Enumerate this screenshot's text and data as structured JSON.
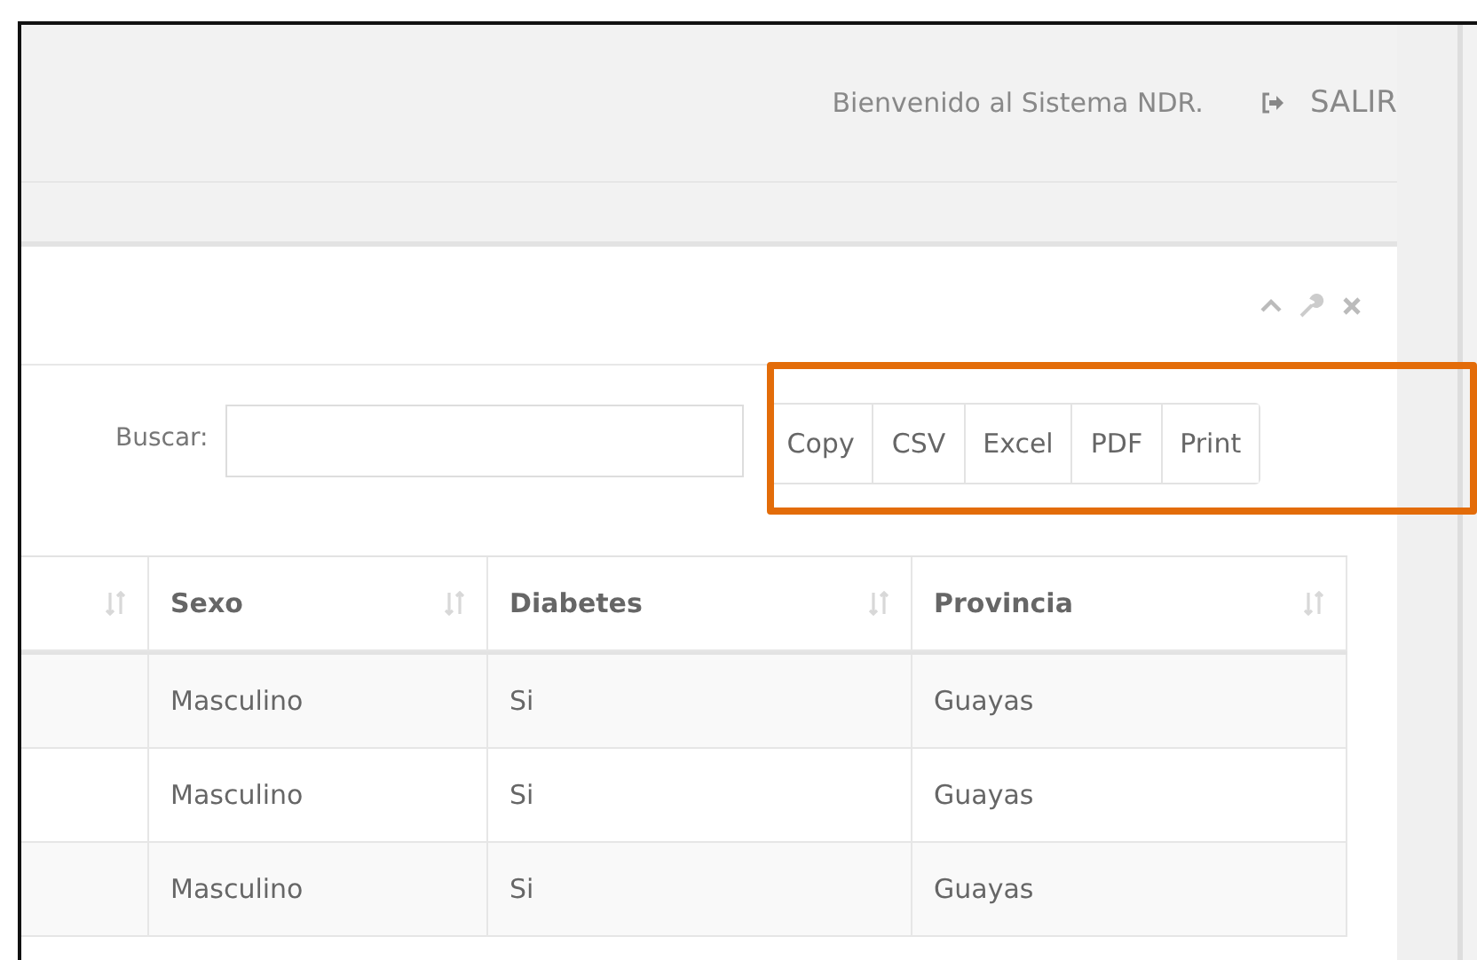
{
  "header": {
    "welcome": "Bienvenido al Sistema NDR.",
    "logout": "SALIR"
  },
  "panel": {
    "search_label": "Buscar:",
    "export_buttons": [
      "Copy",
      "CSV",
      "Excel",
      "PDF",
      "Print"
    ],
    "highlighted": true
  },
  "table": {
    "columns": [
      {
        "kind": "blank"
      },
      {
        "kind": "text",
        "label": "Sexo"
      },
      {
        "kind": "text",
        "label": "Diabetes"
      },
      {
        "kind": "text",
        "label": "Provincia"
      }
    ],
    "rows": [
      [
        "",
        "Masculino",
        "Si",
        "Guayas"
      ],
      [
        "",
        "Masculino",
        "Si",
        "Guayas"
      ],
      [
        "",
        "Masculino",
        "Si",
        "Guayas"
      ]
    ]
  }
}
